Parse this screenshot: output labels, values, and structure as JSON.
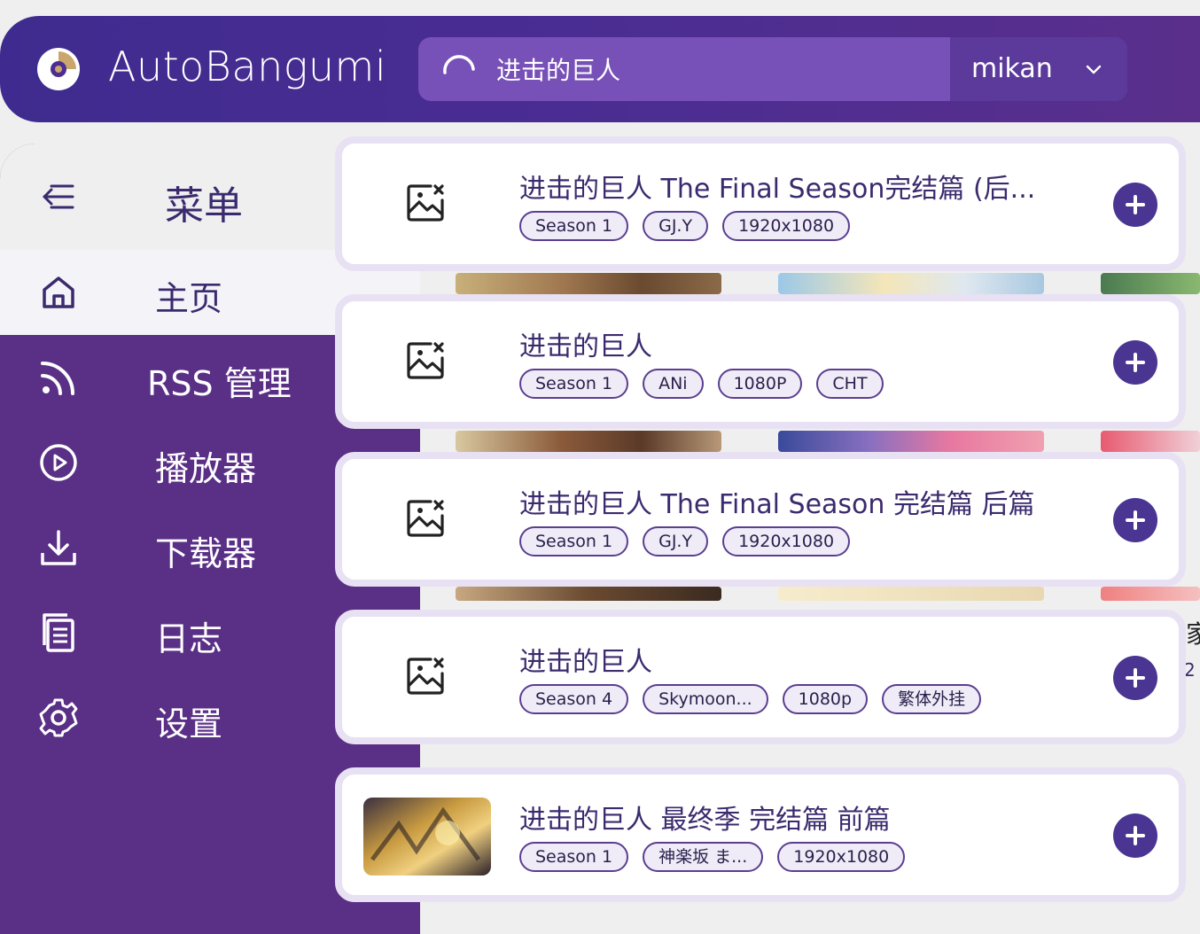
{
  "app": {
    "title": "AutoBangumi"
  },
  "search": {
    "value": "进击的巨人",
    "source": "mikan"
  },
  "sidebar": {
    "menu_title": "菜单",
    "items": [
      {
        "label": "主页",
        "icon": "home-icon",
        "active": true
      },
      {
        "label": "RSS 管理",
        "icon": "rss-icon",
        "active": false
      },
      {
        "label": "播放器",
        "icon": "play-circle-icon",
        "active": false
      },
      {
        "label": "下载器",
        "icon": "download-icon",
        "active": false
      },
      {
        "label": "日志",
        "icon": "log-icon",
        "active": false
      },
      {
        "label": "设置",
        "icon": "gear-icon",
        "active": false
      }
    ]
  },
  "background": {
    "partial_text_1": "家",
    "partial_text_2": "2"
  },
  "results": [
    {
      "title": "进击的巨人 The Final Season完结篇 (后...",
      "tags": [
        "Season 1",
        "GJ.Y",
        "1920x1080"
      ],
      "thumbnail": "image-placeholder-icon"
    },
    {
      "title": "进击的巨人",
      "tags": [
        "Season 1",
        "ANi",
        "1080P",
        "CHT"
      ],
      "thumbnail": "image-placeholder-icon"
    },
    {
      "title": "进击的巨人 The Final Season 完结篇 后篇",
      "tags": [
        "Season 1",
        "GJ.Y",
        "1920x1080"
      ],
      "thumbnail": "image-placeholder-icon"
    },
    {
      "title": "进击的巨人",
      "tags": [
        "Season 4",
        "Skymoon...",
        "1080p",
        "繁体外挂"
      ],
      "thumbnail": "image-placeholder-icon"
    },
    {
      "title": "进击的巨人 最终季 完结篇 前篇",
      "tags": [
        "Season 1",
        "神楽坂 ま...",
        "1920x1080"
      ],
      "thumbnail": "poster-thumbnail"
    }
  ],
  "colors": {
    "primary": "#4a3592",
    "sidebar": "#5a2f86",
    "topbar": "#4c2d92",
    "search": "#7750b8"
  }
}
